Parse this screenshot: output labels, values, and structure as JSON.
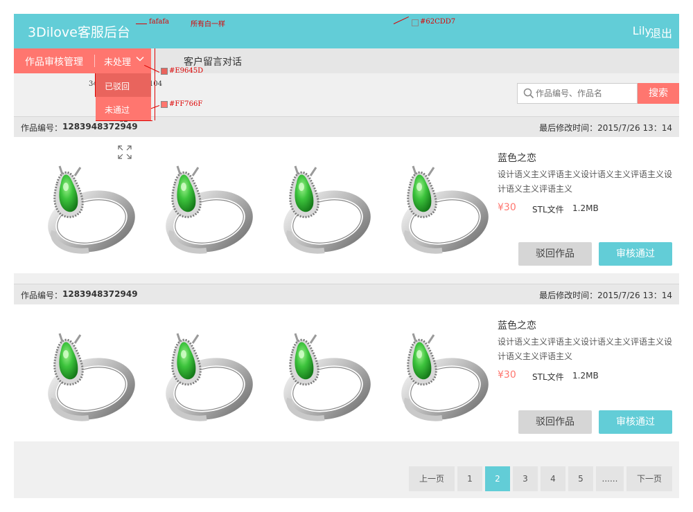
{
  "header": {
    "brand": "3Dilove客服后台",
    "user": "Lily",
    "logout": "退出"
  },
  "annotations": {
    "bg_color_note": "fafafa",
    "same_white_note": "所有白一样",
    "header_color": "#62CDD7",
    "dropdown_first_color": "#E9645D",
    "dropdown_second_color": "#FF766F",
    "dim_item_height": "34",
    "dim_total_height": "104",
    "dim_width": "82"
  },
  "nav": {
    "title": "作品审核管理",
    "status_selected": "未处理",
    "chat": "客户留言对话"
  },
  "dropdown": {
    "items": [
      "已驳回",
      "未通过"
    ]
  },
  "search": {
    "placeholder": "作品编号、作品名",
    "button": "搜索"
  },
  "items": [
    {
      "id_label": "作品编号：",
      "id": "1283948372949",
      "time": "最后修改时间：2015/7/26  13：14",
      "name": "蓝色之恋",
      "desc": "设计语义主义评语主义设计语义主义评语主义设计语义主义评语主义",
      "price": "¥30",
      "format": "STL文件",
      "size": "1.2MB",
      "reject": "驳回作品",
      "approve": "审核通过"
    },
    {
      "id_label": "作品编号：",
      "id": "1283948372949",
      "time": "最后修改时间：2015/7/26  13：14",
      "name": "蓝色之恋",
      "desc": "设计语义主义评语主义设计语义主义评语主义设计语义主义评语主义",
      "price": "¥30",
      "format": "STL文件",
      "size": "1.2MB",
      "reject": "驳回作品",
      "approve": "审核通过"
    }
  ],
  "pagination": {
    "prev": "上一页",
    "pages": [
      "1",
      "2",
      "3",
      "4",
      "5"
    ],
    "ellipsis": "......",
    "next": "下一页",
    "current": "2"
  },
  "colors": {
    "header": "#62CDD7",
    "accent": "#FF766F",
    "accent_dark": "#E9645D",
    "background": "#f0f0f0"
  },
  "icons": [
    "search-icon",
    "chevron-down-icon",
    "expand-icon",
    "ring-image"
  ]
}
